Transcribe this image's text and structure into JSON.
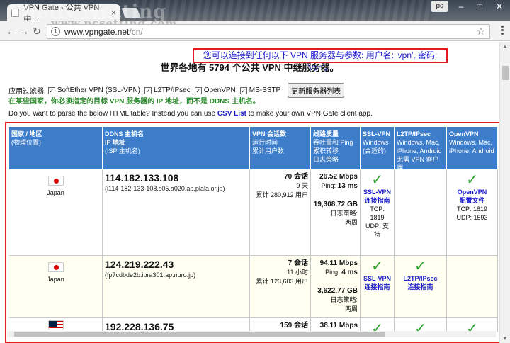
{
  "browser": {
    "tab_title": "VPN Gate - 公共 VPN 中…",
    "tab_close": "×",
    "watermark": "Shelly Netting",
    "watermark_sub": "www.pcsetting.com",
    "profile_label": "pc",
    "url_host": "www.vpngate.net",
    "url_path": "/cn/",
    "info_glyph": "i",
    "star_glyph": "☆"
  },
  "page": {
    "headline": "世界各地有 5794 个公共 VPN 中继服务器。",
    "credentials": "您可以连接到任何以下 VPN 服务器与参数: 用户名: 'vpn', 密码: 'vpn'。",
    "filter_label": "应用过滤器:",
    "filters": [
      {
        "label": "SoftEther VPN (SSL-VPN)",
        "checked": "✓"
      },
      {
        "label": "L2TP/IPsec",
        "checked": "✓"
      },
      {
        "label": "OpenVPN",
        "checked": "✓"
      },
      {
        "label": "MS-SSTP",
        "checked": "✓"
      }
    ],
    "refresh_button": "更新服务器列表",
    "warning": "在某些国家，你必须指定的目标 VPN 服务器的 IP 地址，而不是 DDNS 主机名。",
    "parse_prefix": "Do you want to parse the below HTML table? Instead you can use ",
    "parse_link": "CSV List",
    "parse_suffix": " to make your own VPN Gate client app."
  },
  "table": {
    "headers": [
      {
        "bold": "国家 / 地区",
        "lines": [
          "(物理位置)"
        ]
      },
      {
        "bold": "DDNS 主机名",
        "lines": [
          "IP 地址",
          "(ISP 主机名)"
        ]
      },
      {
        "bold": "VPN 会话数",
        "lines": [
          "运行时间",
          "累计用户数"
        ]
      },
      {
        "bold": "线路质量",
        "lines": [
          "吞吐量和 Ping",
          "累积转移",
          "日志策略"
        ]
      },
      {
        "bold": "SSL-VPN",
        "lines": [
          "Windows",
          "(合适的)"
        ]
      },
      {
        "bold": "L2TP/IPsec",
        "lines": [
          "Windows, Mac,",
          "iPhone, Android",
          "无需 VPN 客户端"
        ]
      },
      {
        "bold": "OpenVPN",
        "lines": [
          "Windows, Mac,",
          "iPhone, Android"
        ]
      }
    ],
    "rows": [
      {
        "country": "Japan",
        "flag": "jp",
        "ip": "114.182.133.108",
        "host": "(i114-182-133-108.s05.a020.ap.plala.or.jp)",
        "sessions": "70 会话",
        "uptime": "9 天",
        "users": "累计 280,912 用户",
        "speed": "26.52 Mbps",
        "ping_label": "Ping:",
        "ping": "13 ms",
        "transfer": "19,308.72 GB",
        "log_label": "日志策略:",
        "log": "两周",
        "ssl_check": "✓",
        "ssl_link1": "SSL-VPN",
        "ssl_link2": "连接指南",
        "ssl_tcp": "TCP: 1819",
        "ssl_udp": "UDP: 支持",
        "l2tp_check": "",
        "l2tp_link1": "",
        "l2tp_link2": "",
        "ovpn_check": "✓",
        "ovpn_link1": "OpenVPN",
        "ovpn_link2": "配置文件",
        "ovpn_tcp": "TCP: 1819",
        "ovpn_udp": "UDP: 1593"
      },
      {
        "country": "Japan",
        "flag": "jp",
        "ip": "124.219.222.43",
        "host": "(fp7cdbde2b.ibra301.ap.nuro.jp)",
        "sessions": "7 会话",
        "uptime": "11 小时",
        "users": "累计 123,603 用户",
        "speed": "94.11 Mbps",
        "ping_label": "Ping:",
        "ping": "4 ms",
        "transfer": "3,622.77 GB",
        "log_label": "日志策略:",
        "log": "两周",
        "ssl_check": "✓",
        "ssl_link1": "SSL-VPN",
        "ssl_link2": "连接指南",
        "ssl_tcp": "",
        "ssl_udp": "",
        "l2tp_check": "✓",
        "l2tp_link1": "L2TP/IPsec",
        "l2tp_link2": "连接指南",
        "ovpn_check": "",
        "ovpn_link1": "",
        "ovpn_link2": "",
        "ovpn_tcp": "",
        "ovpn_udp": ""
      },
      {
        "country": "",
        "flag": "my",
        "ip": "192.228.136.75",
        "host": "",
        "sessions": "159 会话",
        "speed": "38.11 Mbps",
        "ssl_check": "✓",
        "l2tp_check": "✓",
        "ovpn_check": "✓"
      }
    ]
  }
}
